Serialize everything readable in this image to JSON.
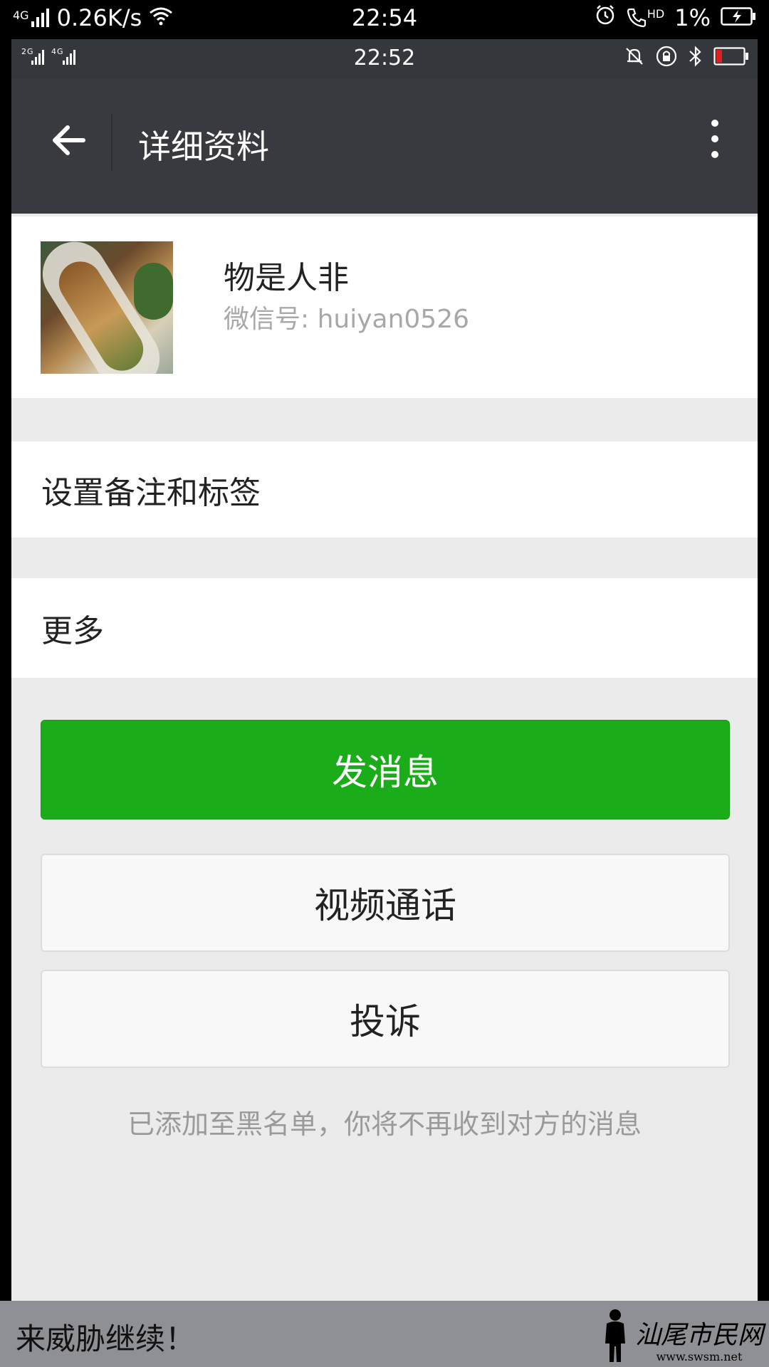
{
  "outer_status": {
    "network": "4G",
    "speed": "0.26K/s",
    "time": "22:54",
    "hd": "HD",
    "battery": "1%"
  },
  "inner_status": {
    "networks": "2G 4G",
    "time": "22:52"
  },
  "header": {
    "title": "详细资料"
  },
  "profile": {
    "nickname": "物是人非",
    "wechat_id": "微信号: huiyan0526"
  },
  "rows": {
    "remark": "设置备注和标签",
    "more": "更多"
  },
  "buttons": {
    "send": "发消息",
    "video": "视频通话",
    "report": "投诉"
  },
  "blacklist_tip": "已添加至黑名单，你将不再收到对方的消息",
  "caption": "来威胁继续！",
  "watermark": {
    "text": "汕尾市民网",
    "url": "www.swsm.net"
  },
  "colors": {
    "primary_green": "#1aad19",
    "titlebar": "#393a3f",
    "background": "#ebebeb"
  }
}
